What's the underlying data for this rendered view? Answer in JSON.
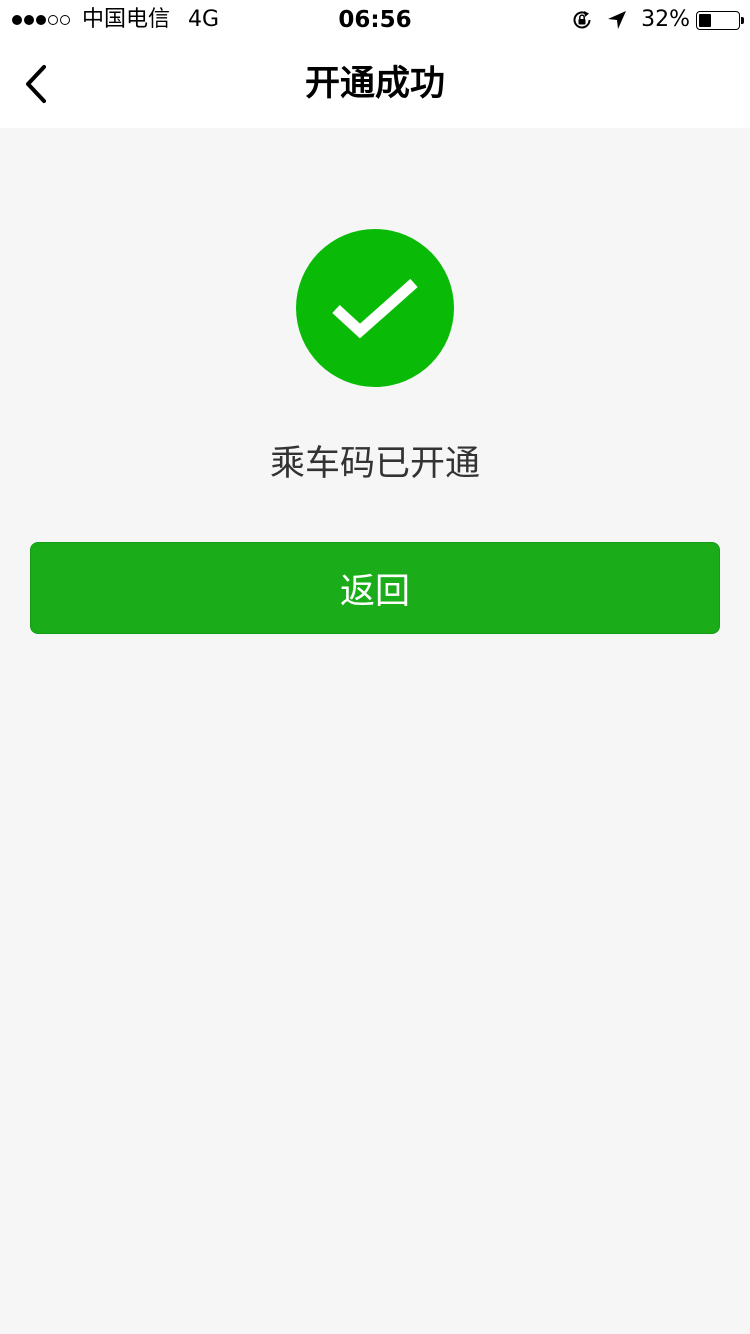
{
  "status_bar": {
    "carrier": "中国电信",
    "network": "4G",
    "time": "06:56",
    "battery_percent": "32%",
    "battery_level": 0.32,
    "signal_bars_filled": 3,
    "signal_bars_total": 5,
    "icons": [
      "signal-dots-icon",
      "rotation-lock-icon",
      "location-arrow-icon",
      "battery-icon"
    ]
  },
  "nav": {
    "back_icon": "chevron-left-icon",
    "title": "开通成功"
  },
  "main": {
    "success_icon": "checkmark-circle-icon",
    "message": "乘车码已开通",
    "return_button_label": "返回"
  },
  "colors": {
    "success_green": "#09bb07",
    "button_green": "#1aad19",
    "page_background": "#f6f6f6",
    "bar_background": "#ffffff",
    "message_text": "#333333"
  }
}
